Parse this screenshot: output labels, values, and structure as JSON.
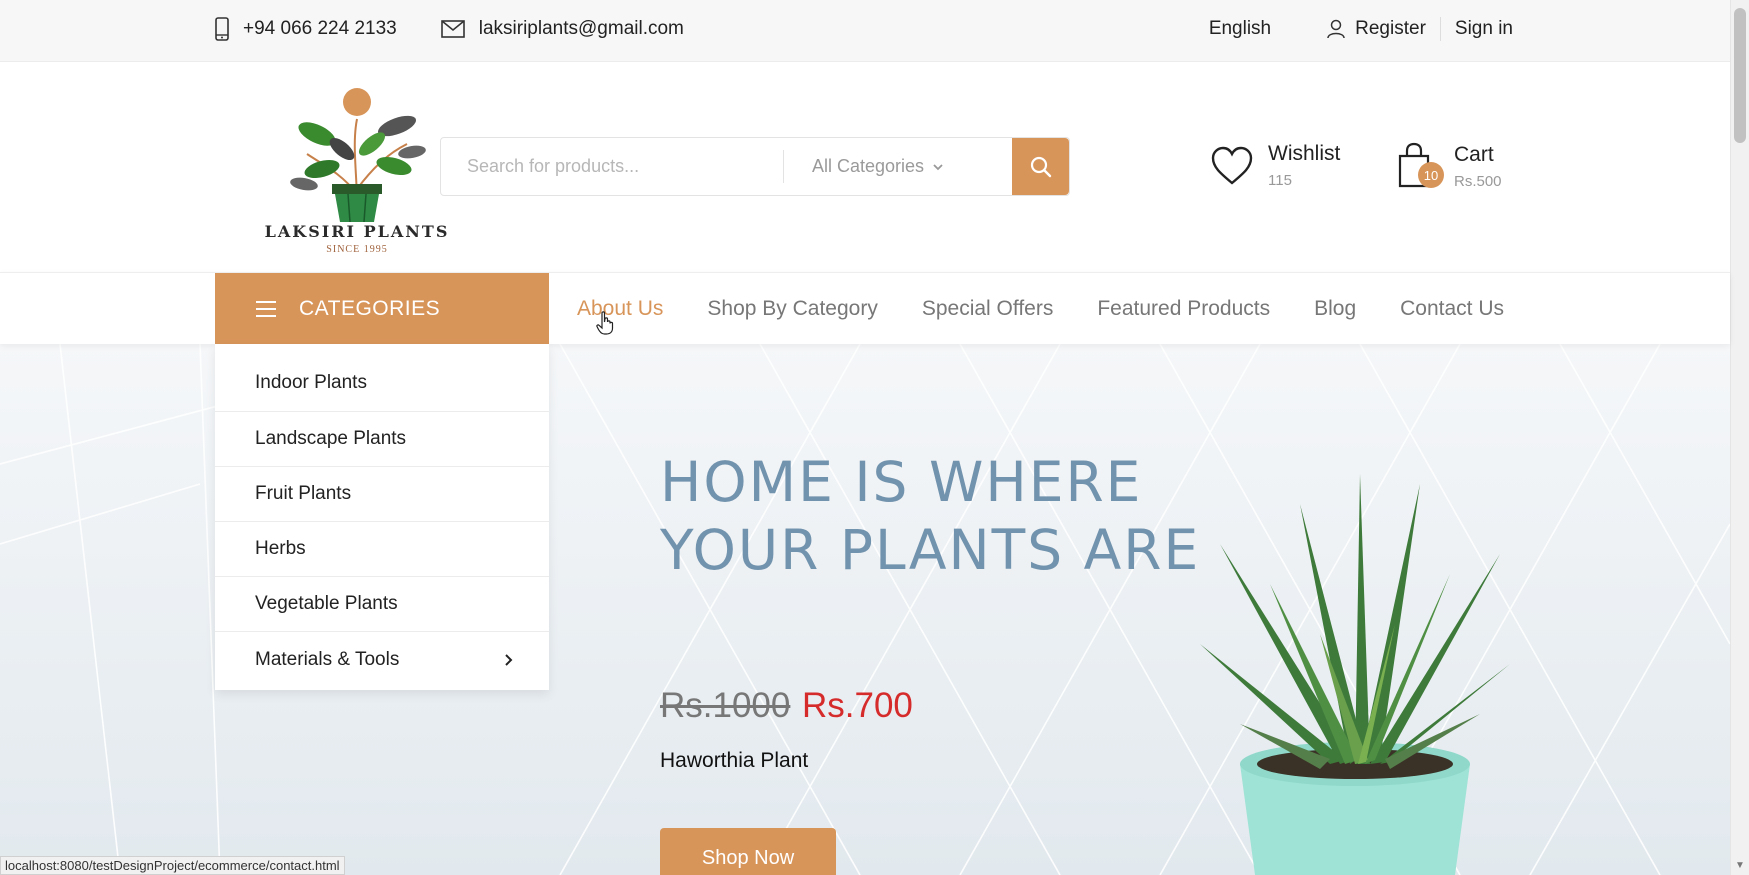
{
  "topbar": {
    "phone": "+94 066 224 2133",
    "email": "laksiriplants@gmail.com",
    "language": "English",
    "register": "Register",
    "signin": "Sign in"
  },
  "header": {
    "logo_name": "LAKSIRI PLANTS",
    "logo_since": "SINCE 1995",
    "search_placeholder": "Search for products...",
    "category_select": "All Categories",
    "wishlist_label": "Wishlist",
    "wishlist_count": "115",
    "cart_label": "Cart",
    "cart_total": "Rs.500",
    "cart_count": "10"
  },
  "nav": {
    "categories_label": "CATEGORIES",
    "items": [
      "About Us",
      "Shop By Category",
      "Special Offers",
      "Featured Products",
      "Blog",
      "Contact Us"
    ]
  },
  "dropdown": {
    "items": [
      "Indoor Plants",
      "Landscape Plants",
      "Fruit Plants",
      "Herbs",
      "Vegetable Plants",
      "Materials & Tools"
    ]
  },
  "hero": {
    "title_line1": "HOME IS WHERE",
    "title_line2": "YOUR PLANTS ARE",
    "old_price": "Rs.1000",
    "new_price": "Rs.700",
    "product_name": "Haworthia Plant",
    "button": "Shop Now"
  },
  "status_url": "localhost:8080/testDesignProject/ecommerce/contact.html",
  "colors": {
    "accent": "#d8955a",
    "hero_title": "#7293ad",
    "sale_price": "#d62b2b"
  }
}
